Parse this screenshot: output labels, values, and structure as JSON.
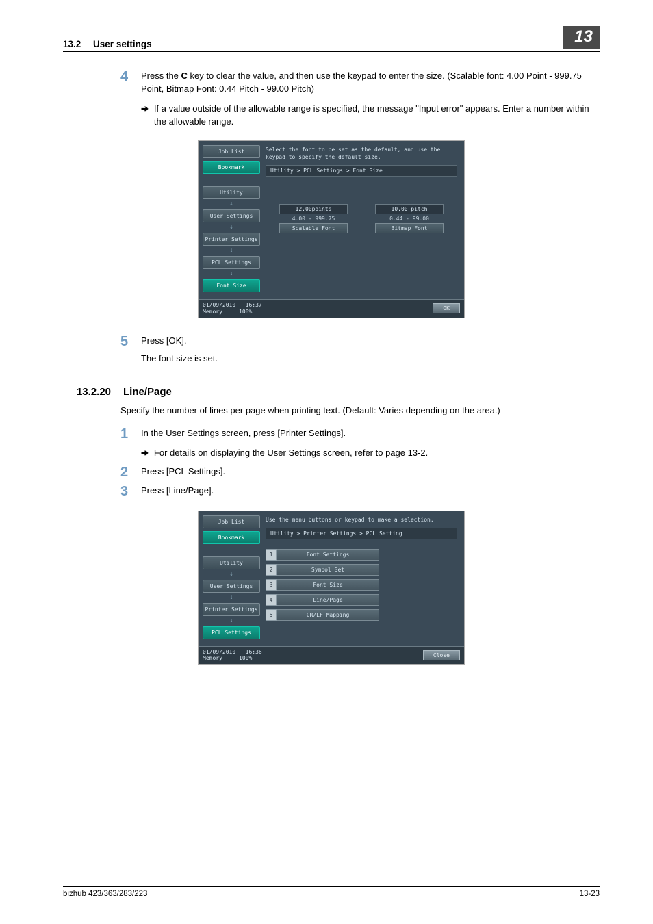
{
  "header": {
    "section_num": "13.2",
    "section_title": "User settings",
    "chapter_badge": "13"
  },
  "step4": {
    "num": "4",
    "text_pre": "Press the ",
    "key": "C",
    "text_post": " key to clear the value, and then use the keypad to enter the size. (Scalable font: 4.00 Point - 999.75 Point, Bitmap Font: 0.44 Pitch - 99.00 Pitch)",
    "bullet": "If a value outside of the allowable range is specified, the message \"Input error\" appears. Enter a number within the allowable range."
  },
  "panel1": {
    "job_list": "Job List",
    "bookmark": "Bookmark",
    "instruction": "Select the font to be set as the default, and use the keypad to specify the default size.",
    "breadcrumb": "Utility > PCL Settings > Font Size",
    "crumbs": [
      "Utility",
      "User Settings",
      "Printer Settings",
      "PCL Settings",
      "Font Size"
    ],
    "left": {
      "value": "12.00points",
      "range": "4.00 - 999.75",
      "type": "Scalable Font"
    },
    "right": {
      "value": "10.00 pitch",
      "range": "0.44 - 99.00",
      "type": "Bitmap Font"
    },
    "footer": {
      "date": "01/09/2010",
      "time": "16:37",
      "mem_label": "Memory",
      "mem_val": "100%",
      "ok": "OK"
    }
  },
  "step5": {
    "num": "5",
    "line1": "Press [OK].",
    "line2": "The font size is set."
  },
  "sect": {
    "num": "13.2.20",
    "title": "Line/Page",
    "intro": "Specify the number of lines per page when printing text. (Default: Varies depending on the area.)"
  },
  "step_s1": {
    "num": "1",
    "text": "In the User Settings screen, press [Printer Settings].",
    "bullet": "For details on displaying the User Settings screen, refer to page 13-2."
  },
  "step_s2": {
    "num": "2",
    "text": "Press [PCL Settings]."
  },
  "step_s3": {
    "num": "3",
    "text": "Press [Line/Page]."
  },
  "panel2": {
    "job_list": "Job List",
    "bookmark": "Bookmark",
    "instruction": "Use the menu buttons or keypad to make a selection.",
    "breadcrumb": "Utility > Printer Settings > PCL Setting",
    "crumbs": [
      "Utility",
      "User Settings",
      "Printer Settings",
      "PCL Settings"
    ],
    "items": [
      {
        "n": "1",
        "label": "Font Settings"
      },
      {
        "n": "2",
        "label": "Symbol Set"
      },
      {
        "n": "3",
        "label": "Font Size"
      },
      {
        "n": "4",
        "label": "Line/Page"
      },
      {
        "n": "5",
        "label": "CR/LF Mapping"
      }
    ],
    "footer": {
      "date": "01/09/2010",
      "time": "16:36",
      "mem_label": "Memory",
      "mem_val": "100%",
      "close": "Close"
    }
  },
  "footer": {
    "model": "bizhub 423/363/283/223",
    "page": "13-23"
  }
}
